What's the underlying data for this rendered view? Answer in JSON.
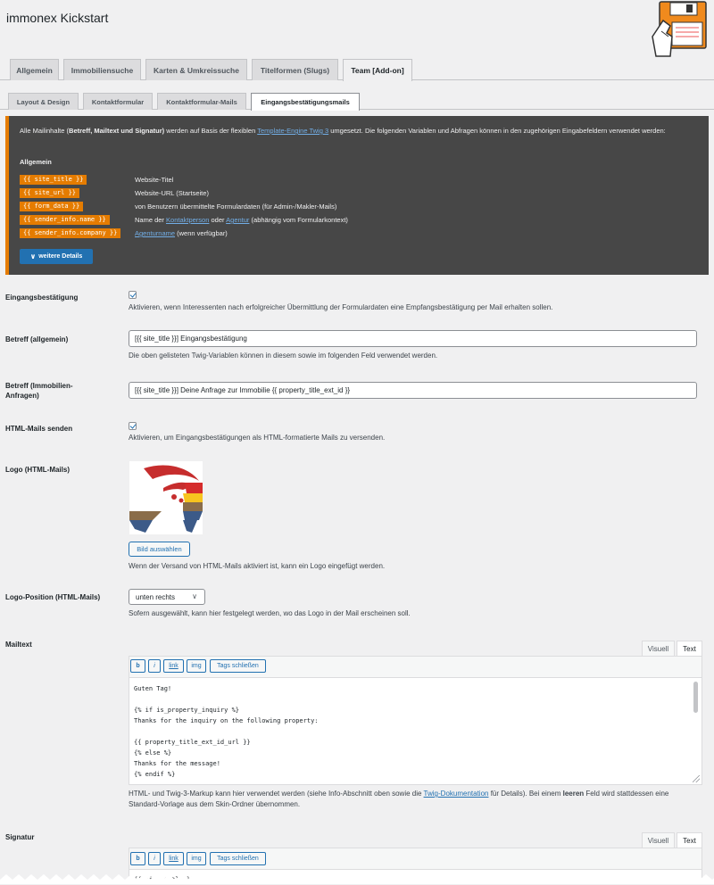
{
  "app": {
    "title": "immonex Kickstart"
  },
  "main_tabs": [
    "Allgemein",
    "Immobiliensuche",
    "Karten & Umkreissuche",
    "Titelformen (Slugs)",
    "Team [Add-on]"
  ],
  "sub_tabs": [
    "Layout & Design",
    "Kontaktformular",
    "Kontaktformular-Mails",
    "Eingangsbestätigungsmails"
  ],
  "info": {
    "intro_1": "Alle Mailinhalte (",
    "intro_bold": "Betreff, Mailtext und Signatur)",
    "intro_2": " werden auf Basis der flexiblen ",
    "intro_link": "Template-Engine Twig 3",
    "intro_3": " umgesetzt. Die folgenden Variablen und Abfragen können in den zugehörigen Eingabefeldern verwendet werden:",
    "section": "Allgemein",
    "vars": [
      {
        "code": "{{ site_title }}",
        "desc": "Website-Titel"
      },
      {
        "code": "{{ site_url }}",
        "desc": "Website-URL (Startseite)"
      },
      {
        "code": "{{ form_data }}",
        "desc": "von Benutzern übermittelte Formulardaten (für Admin-/Makler-Mails)"
      },
      {
        "code": "{{ sender_info.name }}",
        "desc_1": "Name der ",
        "link_1": "Kontaktperson",
        "desc_2": " oder ",
        "link_2": "Agentur",
        "desc_3": " (abhängig vom Formularkontext)"
      },
      {
        "code": "{{ sender_info.company }}",
        "link_1": "Agenturname",
        "desc_2": " (wenn verfügbar)"
      }
    ],
    "details_button": "weitere Details"
  },
  "fields": {
    "confirm": {
      "label": "Eingangsbestätigung",
      "desc": "Aktivieren, wenn Interessenten nach erfolgreicher Übermittlung der Formulardaten eine Empfangsbestätigung per Mail erhalten sollen."
    },
    "subject_general": {
      "label": "Betreff (allgemein)",
      "value": "[{{ site_title }}] Eingangsbestätigung",
      "desc": "Die oben gelisteten Twig-Variablen können in diesem sowie im folgenden Feld verwendet werden."
    },
    "subject_property": {
      "label": "Betreff (Immobilien-Anfragen)",
      "value": "[{{ site_title }}] Deine Anfrage zur Immobilie {{ property_title_ext_id }}"
    },
    "html_mails": {
      "label": "HTML-Mails senden",
      "desc": "Aktivieren, um Eingangsbestätigungen als HTML-formatierte Mails zu versenden."
    },
    "logo": {
      "label": "Logo (HTML-Mails)",
      "button": "Bild auswählen",
      "desc": "Wenn der Versand von HTML-Mails aktiviert ist, kann ein Logo eingefügt werden."
    },
    "logo_position": {
      "label": "Logo-Position (HTML-Mails)",
      "value": "unten rechts",
      "desc": "Sofern ausgewählt, kann hier festgelegt werden, wo das Logo in der Mail erscheinen soll."
    },
    "mailtext": {
      "label": "Mailtext",
      "lines": [
        "Guten Tag!",
        "",
        "{% if is_property_inquiry %}",
        "Thanks for the inquiry on the following property:",
        "",
        "{{ property_title_ext_id_url }}",
        "{% else %}",
        "Thanks for the message!",
        "{% endif %}"
      ],
      "desc_1": "HTML- und Twig-3-Markup kann hier verwendet werden (siehe Info-Abschnitt oben sowie die ",
      "desc_link": "Twig-Dokumentation",
      "desc_2": " für Details). Bei einem ",
      "desc_bold": "leeren",
      "desc_3": " Feld wird stattdessen eine Standard-Vorlage aus dem Skin-Ordner übernommen."
    },
    "signature": {
      "label": "Signatur",
      "partial_line": "{{ site_title }}"
    }
  },
  "editor": {
    "tab_visual": "Visuell",
    "tab_text": "Text",
    "buttons": [
      "b",
      "i",
      "link",
      "img",
      "Tags schließen"
    ]
  }
}
